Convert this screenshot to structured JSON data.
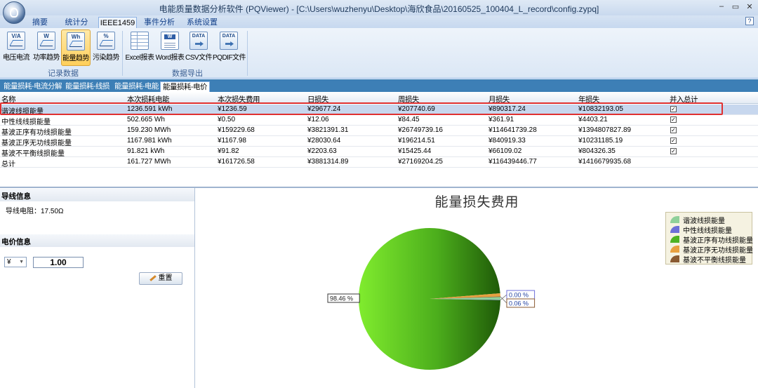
{
  "window": {
    "title": "电能质量数据分析软件 (PQViewer) - [C:\\Users\\wuzhenyu\\Desktop\\海欣食品\\20160525_100404_L_record\\config.zypq]",
    "controls": [
      "–",
      "▭",
      "✕"
    ],
    "help": "?"
  },
  "ribbon": {
    "tabs": [
      "摘要",
      "统计分析",
      "IEEE1459",
      "事件分析",
      "系统设置"
    ],
    "active_tab": "IEEE1459",
    "group1": {
      "label": "记录数据",
      "buttons": [
        {
          "label": "电压电流",
          "icon": "voltage-current-icon",
          "icon_text": "V/A"
        },
        {
          "label": "功率趋势",
          "icon": "power-trend-icon",
          "icon_text": "W"
        },
        {
          "label": "能量趋势",
          "icon": "energy-trend-icon",
          "icon_text": "Wh",
          "selected": true
        },
        {
          "label": "污染趋势",
          "icon": "pollution-trend-icon",
          "icon_text": "%"
        }
      ]
    },
    "group2": {
      "label": "数据导出",
      "buttons": [
        {
          "label": "Excel报表",
          "icon": "excel-report-icon",
          "icon_text": ""
        },
        {
          "label": "Word报表",
          "icon": "word-report-icon",
          "icon_text": "W"
        },
        {
          "label": "CSV文件",
          "icon": "csv-file-icon",
          "icon_text": "DATA"
        },
        {
          "label": "PQDIF文件",
          "icon": "pqdif-file-icon",
          "icon_text": "DATA"
        }
      ]
    }
  },
  "doc_tabs": [
    "能量损耗-电流分解",
    "能量损耗-线损",
    "能量损耗-电能",
    "能量损耗-电价"
  ],
  "active_doc_tab": "能量损耗-电价",
  "table": {
    "columns": [
      "名称",
      "本次损耗电能",
      "本次损失费用",
      "日损失",
      "周损失",
      "月损失",
      "年损失",
      "并入总计"
    ],
    "rows": [
      {
        "name": "谐波线损能量",
        "energy": "1236.591 kWh",
        "cost": "¥1236.59",
        "day": "¥29677.24",
        "week": "¥207740.69",
        "month": "¥890317.24",
        "year": "¥10832193.05",
        "included": true,
        "selected": true
      },
      {
        "name": "中性线线损能量",
        "energy": "502.665 Wh",
        "cost": "¥0.50",
        "day": "¥12.06",
        "week": "¥84.45",
        "month": "¥361.91",
        "year": "¥4403.21",
        "included": true
      },
      {
        "name": "基波正序有功线损能量",
        "energy": "159.230 MWh",
        "cost": "¥159229.68",
        "day": "¥3821391.31",
        "week": "¥26749739.16",
        "month": "¥114641739.28",
        "year": "¥1394807827.89",
        "included": true
      },
      {
        "name": "基波正序无功线损能量",
        "energy": "1167.981 kWh",
        "cost": "¥1167.98",
        "day": "¥28030.64",
        "week": "¥196214.51",
        "month": "¥840919.33",
        "year": "¥10231185.19",
        "included": true
      },
      {
        "name": "基波不平衡线损能量",
        "energy": "91.821 kWh",
        "cost": "¥91.82",
        "day": "¥2203.63",
        "week": "¥15425.44",
        "month": "¥66109.02",
        "year": "¥804326.35",
        "included": true
      },
      {
        "name": "总计",
        "energy": "161.727 MWh",
        "cost": "¥161726.58",
        "day": "¥3881314.89",
        "week": "¥27169204.25",
        "month": "¥116439446.77",
        "year": "¥1416679935.68",
        "included": null
      }
    ]
  },
  "left_panel": {
    "wire_title": "导线信息",
    "wire_resistance": "导线电阻：17.50Ω",
    "price_title": "电价信息",
    "currency": "¥",
    "price_value": "1.00",
    "reset_label": "重置"
  },
  "chart_data": {
    "type": "pie",
    "title": "能量损失费用",
    "slices": [
      {
        "name": "谐波线损能量",
        "value": 0.76,
        "color": "#8fd09a"
      },
      {
        "name": "中性线线损能量",
        "value": 0.0,
        "label": "0.00 %",
        "color": "#6d6fd8"
      },
      {
        "name": "基波正序有功线损能量",
        "value": 98.46,
        "label": "98.46 %",
        "color": "#4eb324"
      },
      {
        "name": "基波正序无功线损能量",
        "value": 0.72,
        "color": "#e8a040"
      },
      {
        "name": "基波不平衡线损能量",
        "value": 0.06,
        "label": "0.06 %",
        "color": "#8a5a32"
      }
    ],
    "legend_position": "right",
    "legend_items": [
      "谐波线损能量",
      "中性线线损能量",
      "基波正序有功线损能量",
      "基波正序无功线损能量",
      "基波不平衡线损能量"
    ]
  }
}
